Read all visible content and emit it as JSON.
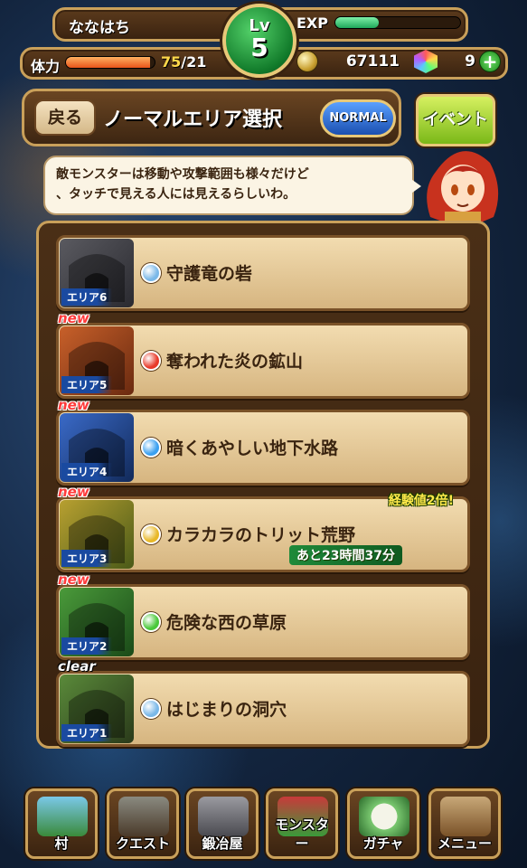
{
  "player": {
    "name": "ななはち",
    "level_label": "Lv",
    "level": "5",
    "exp_label": "EXP",
    "exp_progress": 0.35,
    "stamina_label": "体力",
    "stamina_current": "75",
    "stamina_max": "/21",
    "stamina_progress": 0.95,
    "coins": "67111",
    "gems": "9"
  },
  "header": {
    "back_label": "戻る",
    "title": "ノーマルエリア選択",
    "mode_label": "NORMAL",
    "event_label": "イベント"
  },
  "hint": {
    "line1": "敵モンスターは移動や攻撃範囲も様々だけど",
    "line2": "、タッチで見える人には見えるらしいわ。"
  },
  "areas": [
    {
      "area": "エリア6",
      "name": "守護竜の砦",
      "badge": "",
      "element_color": "#7ab8e8"
    },
    {
      "area": "エリア5",
      "name": "奪われた炎の鉱山",
      "badge": "new",
      "element_color": "#e83a2a"
    },
    {
      "area": "エリア4",
      "name": "暗くあやしい地下水路",
      "badge": "new",
      "element_color": "#3aa0f0"
    },
    {
      "area": "エリア3",
      "name": "カラカラのトリット荒野",
      "badge": "new",
      "element_color": "#e8b828",
      "bonus": "経験値2倍!",
      "timer": "あと23時間37分"
    },
    {
      "area": "エリア2",
      "name": "危険な西の草原",
      "badge": "new",
      "element_color": "#4ac83a"
    },
    {
      "area": "エリア1",
      "name": "はじまりの洞穴",
      "badge": "clear",
      "element_color": "#7ab8e8"
    }
  ],
  "nav": [
    {
      "label": "村"
    },
    {
      "label": "クエスト"
    },
    {
      "label": "鍛冶屋"
    },
    {
      "label": "モンスター"
    },
    {
      "label": "ガチャ"
    },
    {
      "label": "メニュー"
    }
  ],
  "colors": {
    "wood": "#3a2310",
    "gold_trim": "#c9a05a",
    "card": "#f2dcb0",
    "new_badge": "#ff3a3a",
    "area_tag": "#1a4aa0"
  }
}
